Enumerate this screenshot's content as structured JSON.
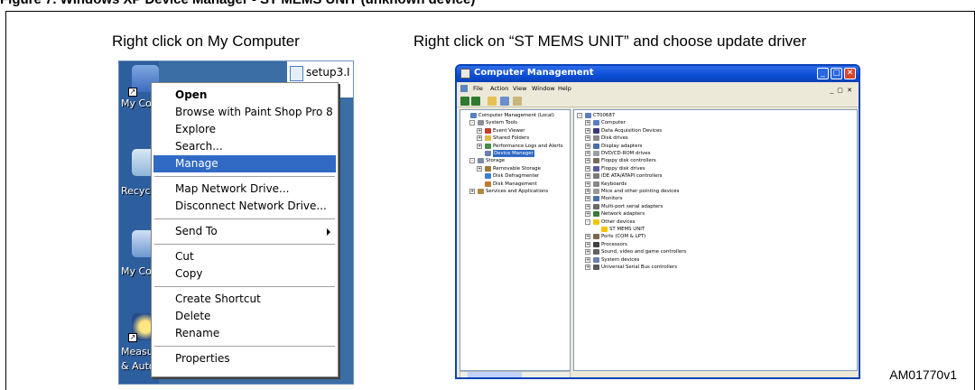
{
  "top_heading": "Figure 7.  Windows XP Device Manager - ST MEMS UNIT (unknown device)",
  "left_panel": {
    "caption": "Right click on My Computer",
    "file_label": "setup3.I",
    "desktop_labels": [
      "My Con",
      "Recyc",
      "My Con",
      "Measur",
      "& Autor"
    ],
    "context_menu": [
      {
        "label": "Open",
        "bold": true
      },
      {
        "label": "Browse with Paint Shop Pro 8"
      },
      {
        "label": "Explore"
      },
      {
        "label": "Search..."
      },
      {
        "label": "Manage",
        "highlighted": true
      },
      {
        "separator": true
      },
      {
        "label": "Map Network Drive..."
      },
      {
        "label": "Disconnect Network Drive..."
      },
      {
        "separator": true
      },
      {
        "label": "Send To",
        "submenu": true
      },
      {
        "separator": true
      },
      {
        "label": "Cut"
      },
      {
        "label": "Copy"
      },
      {
        "separator": true
      },
      {
        "label": "Create Shortcut"
      },
      {
        "label": "Delete"
      },
      {
        "label": "Rename"
      },
      {
        "separator": true
      },
      {
        "label": "Properties"
      }
    ]
  },
  "right_panel": {
    "caption": "Right click on “ST MEMS UNIT” and choose update driver",
    "window_title": "Computer Management",
    "menu": [
      "File",
      "Action",
      "View",
      "Window",
      "Help"
    ],
    "mdi_buttons": "_ ▢ ✕",
    "console_tree": [
      {
        "label": "Computer Management (Local)",
        "level": 0,
        "icon": "computer-icon"
      },
      {
        "label": "System Tools",
        "level": 1,
        "pm": "-",
        "icon": "tools-icon"
      },
      {
        "label": "Event Viewer",
        "level": 2,
        "pm": "+",
        "icon": "event-viewer-icon"
      },
      {
        "label": "Shared Folders",
        "level": 2,
        "pm": "+",
        "icon": "folder-icon"
      },
      {
        "label": "Performance Logs and Alerts",
        "level": 2,
        "pm": "+",
        "icon": "performance-icon"
      },
      {
        "label": "Device Manager",
        "level": 2,
        "selected": true,
        "icon": "device-manager-icon"
      },
      {
        "label": "Storage",
        "level": 1,
        "pm": "-",
        "icon": "storage-icon"
      },
      {
        "label": "Removable Storage",
        "level": 2,
        "pm": "+",
        "icon": "removable-storage-icon"
      },
      {
        "label": "Disk Defragmenter",
        "level": 2,
        "icon": "defrag-icon"
      },
      {
        "label": "Disk Management",
        "level": 2,
        "icon": "disk-management-icon"
      },
      {
        "label": "Services and Applications",
        "level": 1,
        "pm": "+",
        "icon": "services-icon"
      }
    ],
    "device_tree": [
      {
        "label": "CT00687",
        "level": 0,
        "pm": "-",
        "icon": "computer-icon"
      },
      {
        "label": "Computer",
        "level": 1,
        "pm": "+",
        "icon": "computer-icon"
      },
      {
        "label": "Data Acquisition Devices",
        "level": 1,
        "pm": "+",
        "icon": "data-acquisition-icon"
      },
      {
        "label": "Disk drives",
        "level": 1,
        "pm": "+",
        "icon": "disk-drive-icon"
      },
      {
        "label": "Display adapters",
        "level": 1,
        "pm": "+",
        "icon": "display-adapter-icon"
      },
      {
        "label": "DVD/CD-ROM drives",
        "level": 1,
        "pm": "+",
        "icon": "cdrom-icon"
      },
      {
        "label": "Floppy disk controllers",
        "level": 1,
        "pm": "+",
        "icon": "controller-icon"
      },
      {
        "label": "Floppy disk drives",
        "level": 1,
        "pm": "+",
        "icon": "floppy-icon"
      },
      {
        "label": "IDE ATA/ATAPI controllers",
        "level": 1,
        "pm": "+",
        "icon": "ide-icon"
      },
      {
        "label": "Keyboards",
        "level": 1,
        "pm": "+",
        "icon": "keyboard-icon"
      },
      {
        "label": "Mice and other pointing devices",
        "level": 1,
        "pm": "+",
        "icon": "mouse-icon"
      },
      {
        "label": "Monitors",
        "level": 1,
        "pm": "+",
        "icon": "monitor-icon"
      },
      {
        "label": "Multi-port serial adapters",
        "level": 1,
        "pm": "+",
        "icon": "serial-icon"
      },
      {
        "label": "Network adapters",
        "level": 1,
        "pm": "+",
        "icon": "network-icon"
      },
      {
        "label": "Other devices",
        "level": 1,
        "pm": "-",
        "icon": "unknown-device-icon"
      },
      {
        "label": "ST MEMS UNIT",
        "level": 2,
        "icon": "unknown-device-icon"
      },
      {
        "label": "Ports (COM & LPT)",
        "level": 1,
        "pm": "+",
        "icon": "port-icon"
      },
      {
        "label": "Processors",
        "level": 1,
        "pm": "+",
        "icon": "processor-icon"
      },
      {
        "label": "Sound, video and game controllers",
        "level": 1,
        "pm": "+",
        "icon": "sound-icon"
      },
      {
        "label": "System devices",
        "level": 1,
        "pm": "+",
        "icon": "system-devices-icon"
      },
      {
        "label": "Universal Serial Bus controllers",
        "level": 1,
        "pm": "+",
        "icon": "usb-icon"
      }
    ]
  },
  "figure_id": "AM01770v1",
  "colors": {
    "desktop_blue": "#3a6ea5",
    "menu_highlight": "#316ac5",
    "xp_titlebar": "#0a4dd6",
    "xp_face": "#ece9d8",
    "unknown_device_yellow": "#f2c500"
  }
}
